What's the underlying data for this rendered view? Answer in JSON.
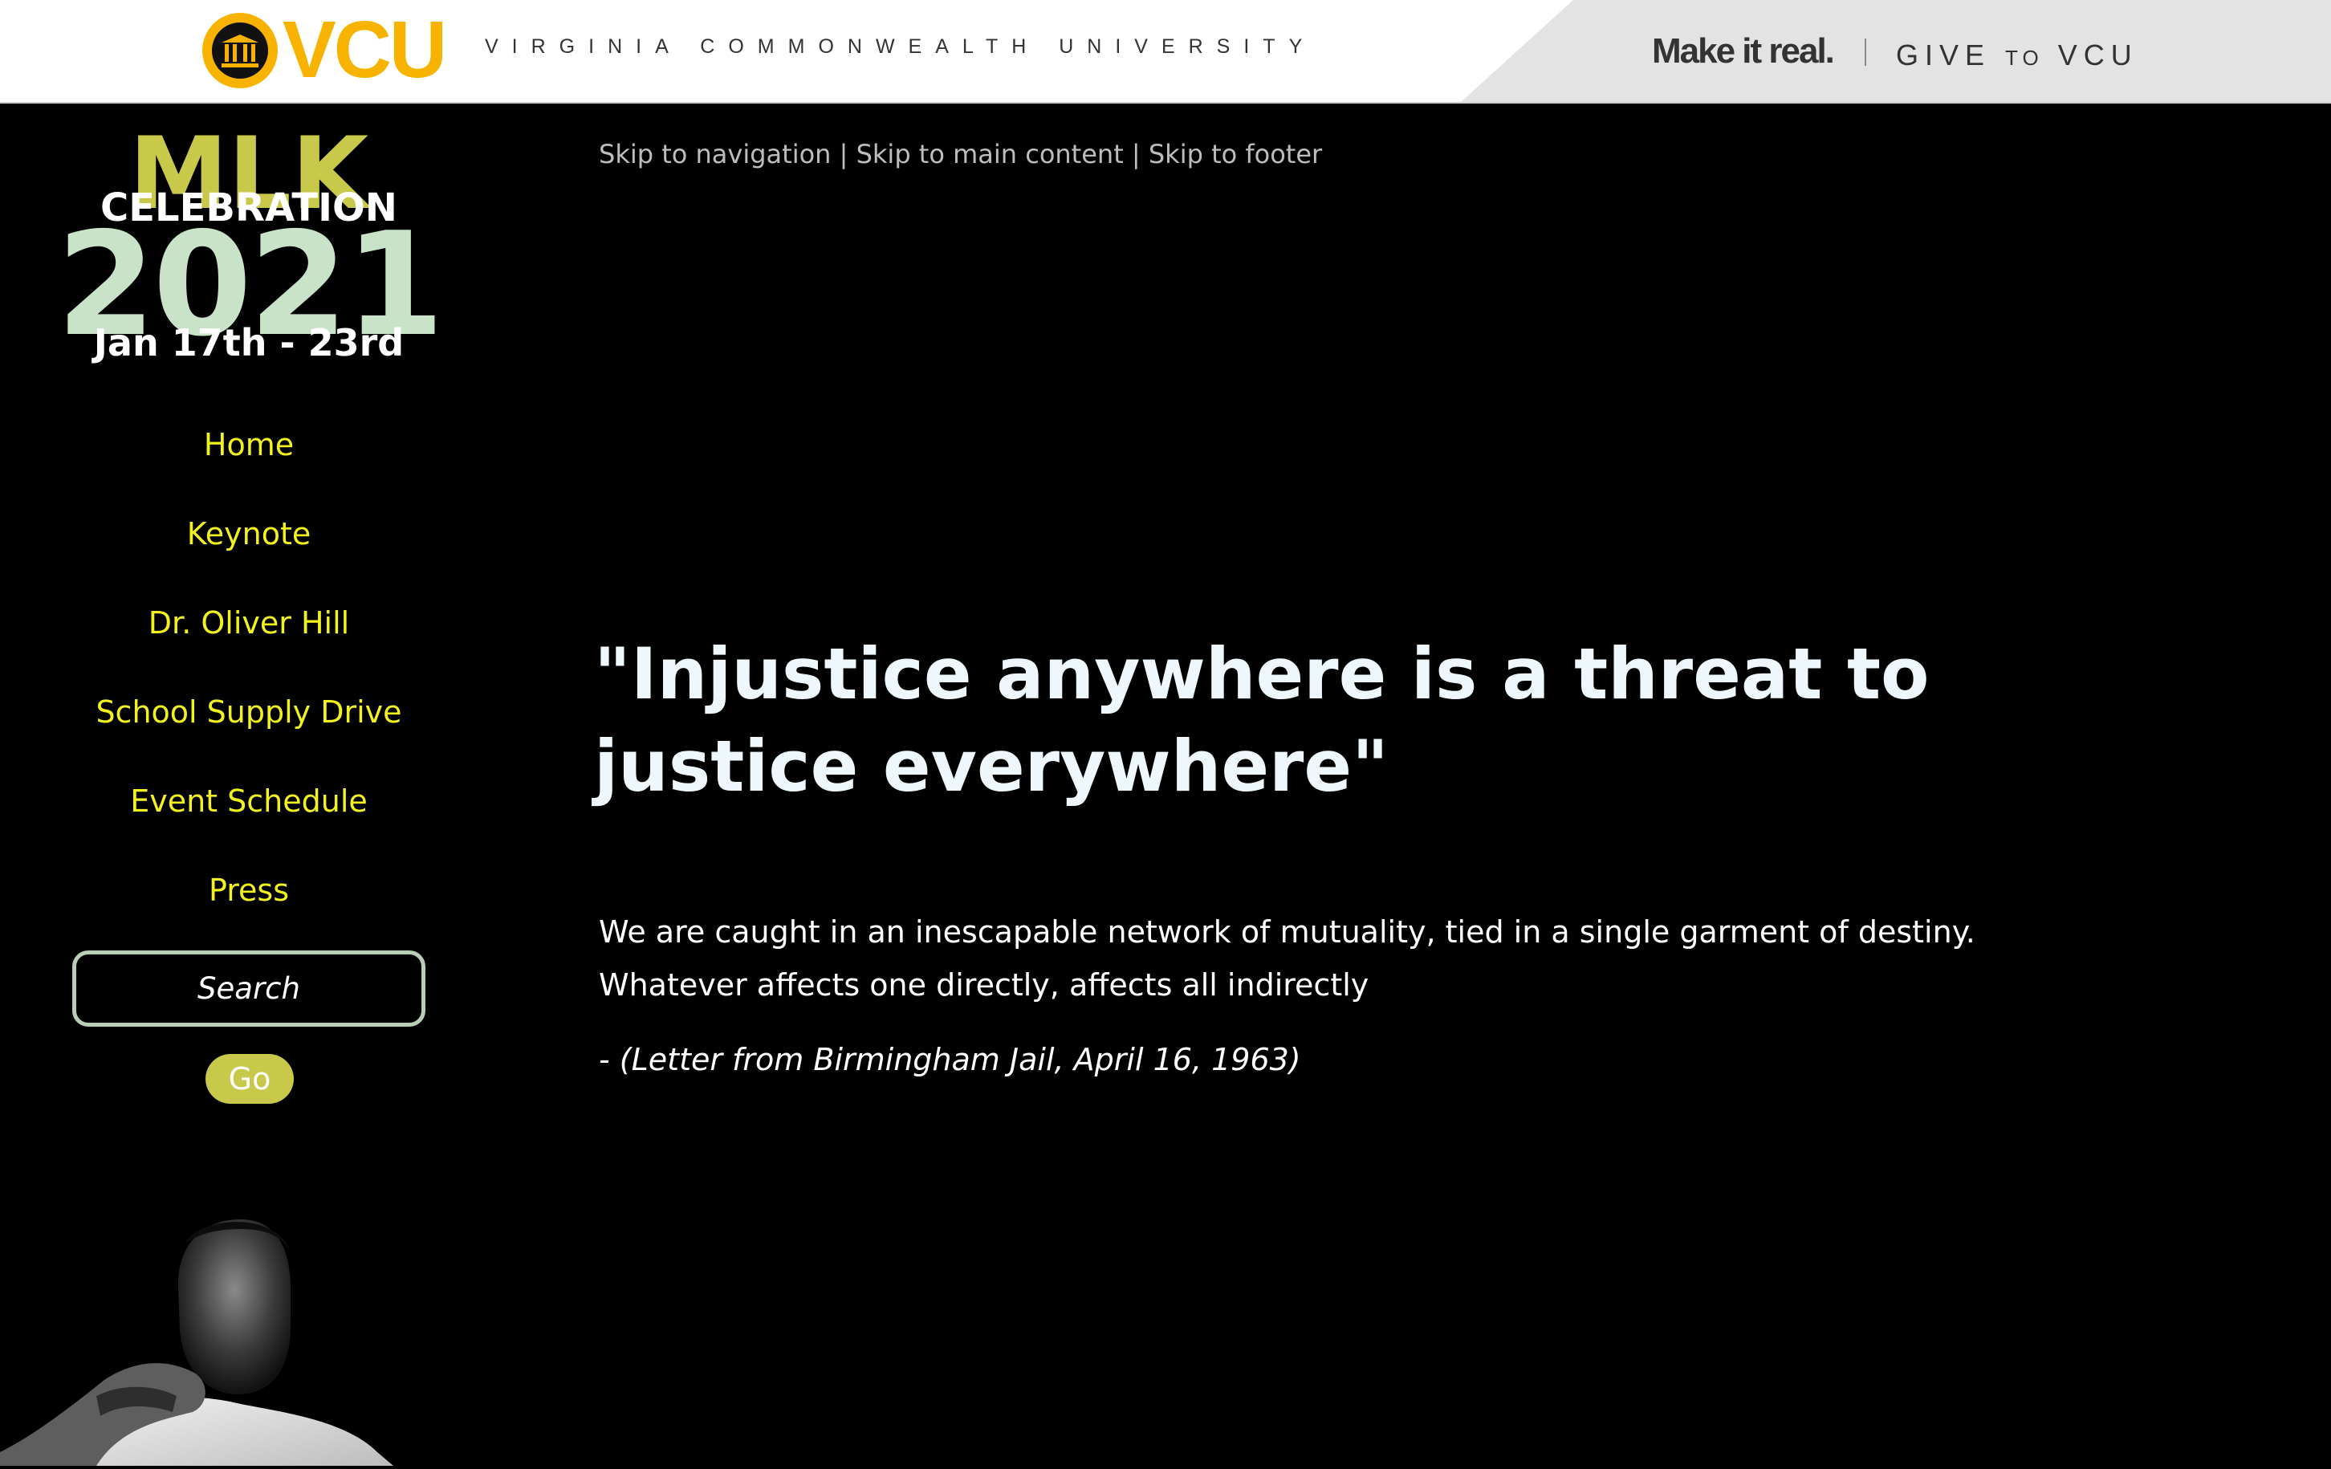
{
  "brand": {
    "logo_text": "VCU",
    "university_name": "VIRGINIA COMMONWEALTH UNIVERSITY",
    "tagline": "Make it real.",
    "give_pre": "GIVE",
    "give_to": "TO",
    "give_post": "VCU",
    "logo_color": "#f8b300"
  },
  "event_logo": {
    "line1": "MLK",
    "line2": "CELEBRATION",
    "year": "2021",
    "dates": "Jan 17th - 23rd"
  },
  "sidebar": {
    "nav_items": [
      {
        "label": "Home"
      },
      {
        "label": "Keynote"
      },
      {
        "label": "Dr. Oliver Hill"
      },
      {
        "label": "School Supply Drive"
      },
      {
        "label": "Event Schedule"
      },
      {
        "label": "Press"
      }
    ],
    "search": {
      "placeholder": "Search",
      "value": ""
    },
    "go_label": "Go"
  },
  "skip_links": {
    "nav": "Skip to navigation",
    "main": "Skip to main content",
    "footer": "Skip to footer",
    "separator": " | "
  },
  "main": {
    "quote_title": "\"Injustice anywhere is a threat to justice everywhere\"",
    "quote_body": "We are caught in an inescapable network of mutuality, tied in a single garment of destiny. Whatever affects one directly, affects all indirectly",
    "quote_source": "- (Letter from Birmingham Jail, April 16, 1963)"
  },
  "colors": {
    "nav_link": "#f2f21f",
    "accent": "#c8c84a",
    "year": "#c8e3c8",
    "background": "#000000"
  }
}
